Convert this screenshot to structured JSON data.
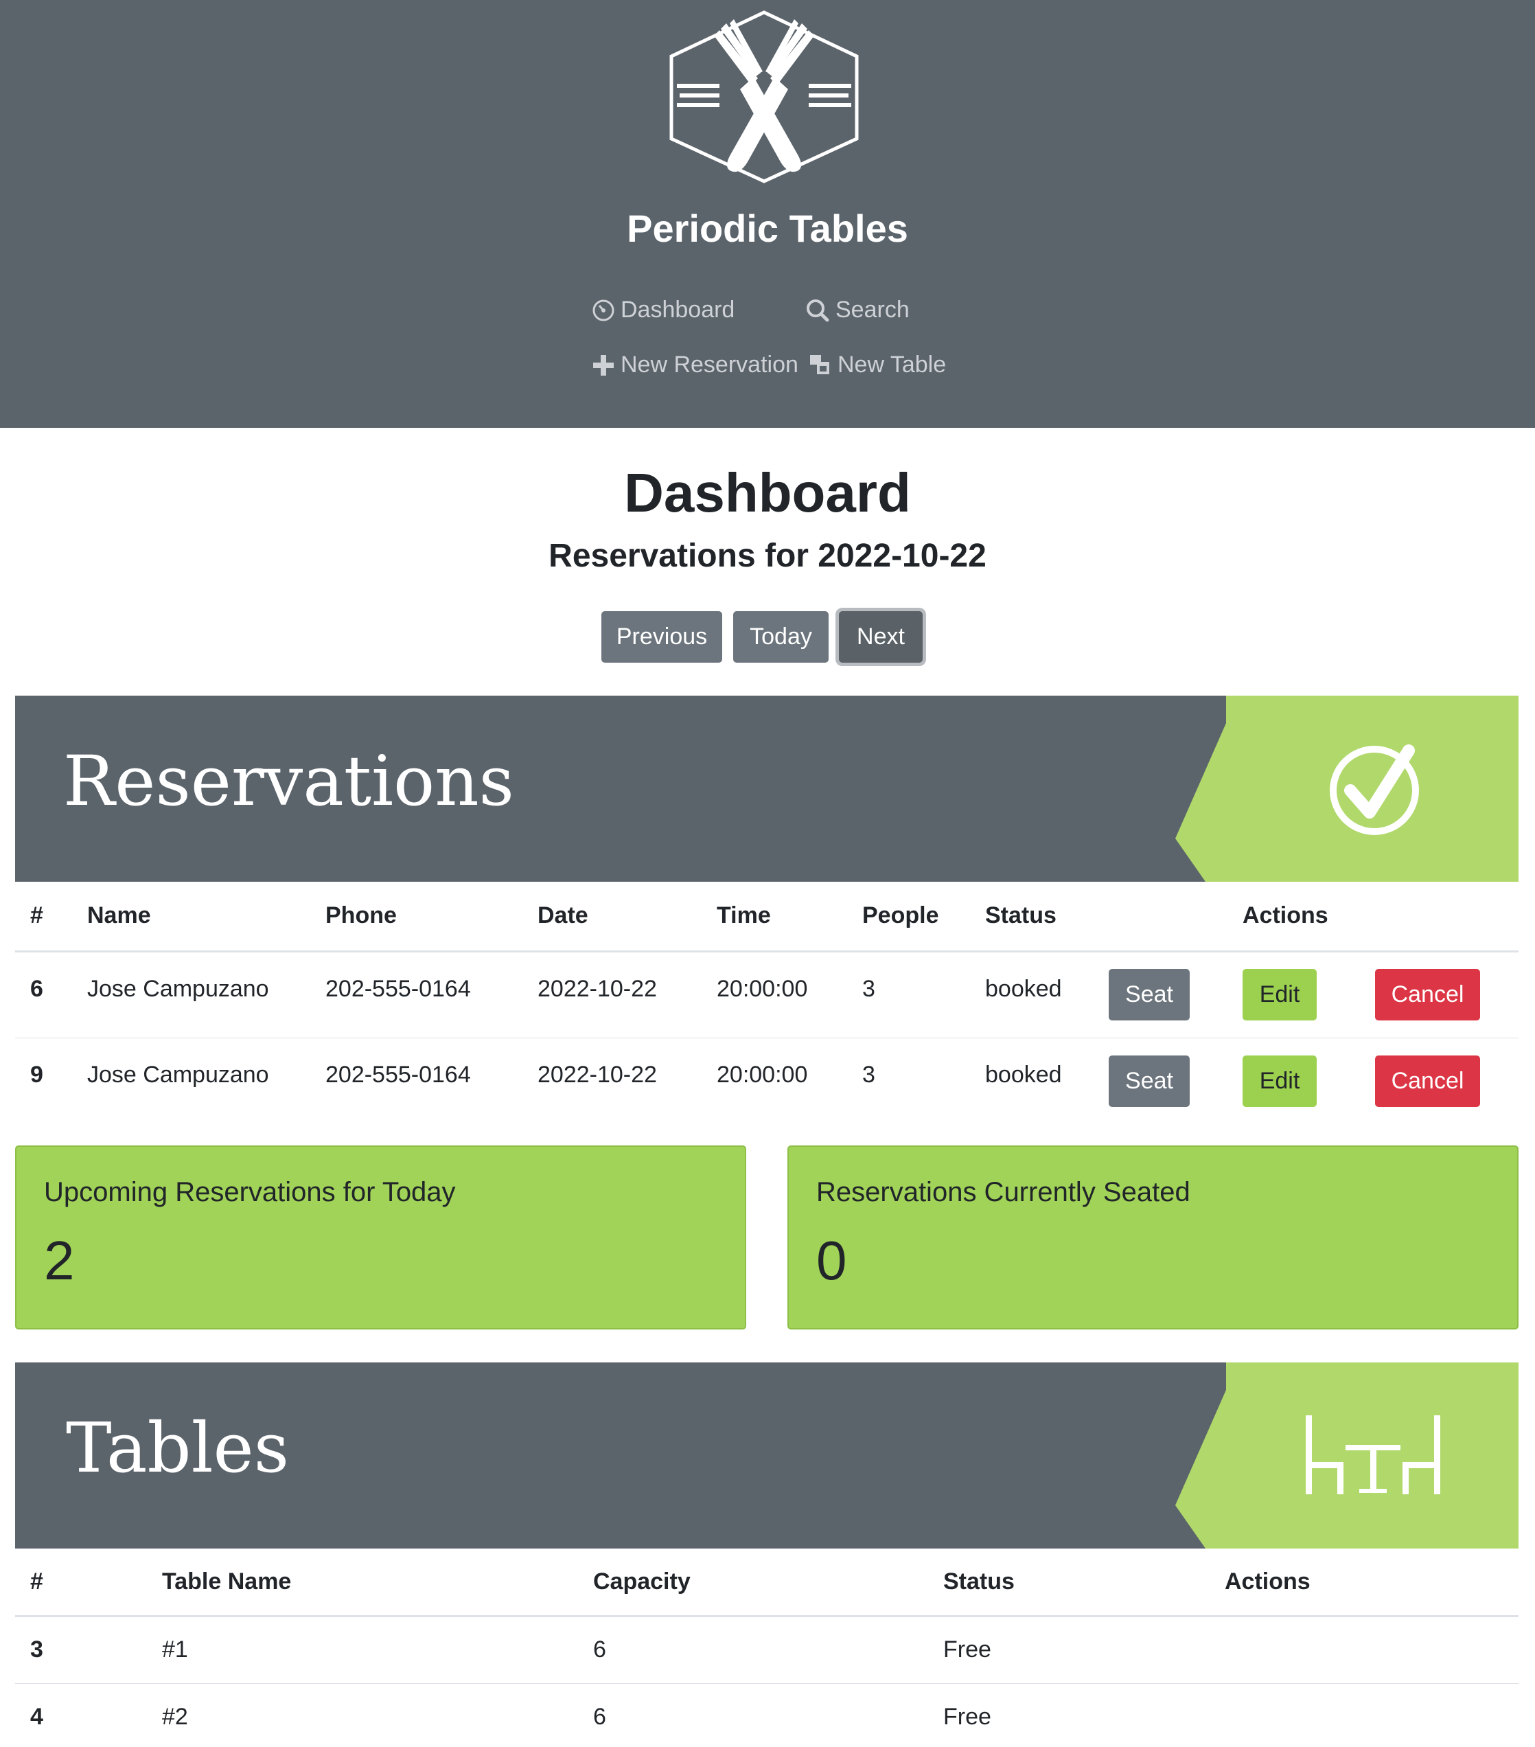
{
  "header": {
    "brand": "Periodic Tables",
    "nav": [
      {
        "label": "Dashboard",
        "icon": "dashboard-icon"
      },
      {
        "label": "Search",
        "icon": "search-icon"
      },
      {
        "label": "New Reservation",
        "icon": "plus-icon"
      },
      {
        "label": "New Table",
        "icon": "table-icon"
      }
    ]
  },
  "main": {
    "title": "Dashboard",
    "subtitle": "Reservations for 2022-10-22",
    "buttons": {
      "previous": "Previous",
      "today": "Today",
      "next": "Next"
    }
  },
  "reservations": {
    "banner_title": "Reservations",
    "banner_icon": "checkmark-circle-icon",
    "columns": [
      "#",
      "Name",
      "Phone",
      "Date",
      "Time",
      "People",
      "Status",
      "",
      "Actions",
      ""
    ],
    "rows": [
      {
        "id": "6",
        "name": "Jose Campuzano",
        "phone": "202-555-0164",
        "date": "2022-10-22",
        "time": "20:00:00",
        "people": "3",
        "status": "booked",
        "seat": "Seat",
        "edit": "Edit",
        "cancel": "Cancel"
      },
      {
        "id": "9",
        "name": "Jose Campuzano",
        "phone": "202-555-0164",
        "date": "2022-10-22",
        "time": "20:00:00",
        "people": "3",
        "status": "booked",
        "seat": "Seat",
        "edit": "Edit",
        "cancel": "Cancel"
      }
    ]
  },
  "cards": {
    "upcoming": {
      "label": "Upcoming Reservations for Today",
      "value": "2"
    },
    "seated": {
      "label": "Reservations Currently Seated",
      "value": "0"
    }
  },
  "tables": {
    "banner_title": "Tables",
    "banner_icon": "dining-table-icon",
    "columns": [
      "#",
      "Table Name",
      "Capacity",
      "Status",
      "Actions"
    ],
    "rows": [
      {
        "id": "3",
        "name": "#1",
        "capacity": "6",
        "status": "Free"
      },
      {
        "id": "4",
        "name": "#2",
        "capacity": "6",
        "status": "Free"
      }
    ]
  },
  "colors": {
    "header_bg": "#5b636b",
    "accent_green": "#9cd14f",
    "card_green": "#a0d357",
    "danger": "#dc3545",
    "secondary": "#6c757d"
  }
}
